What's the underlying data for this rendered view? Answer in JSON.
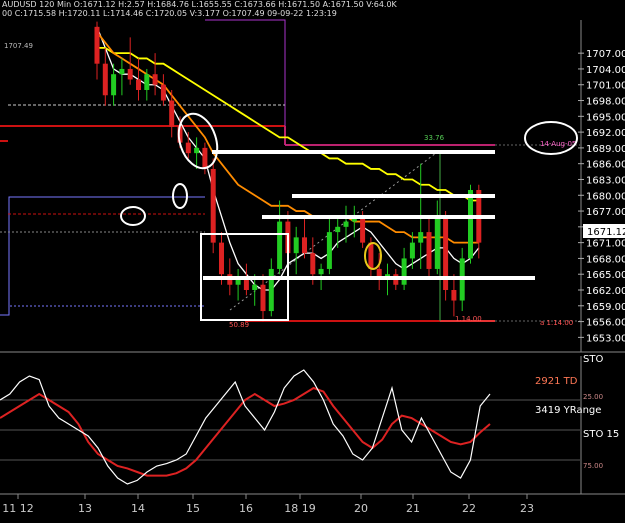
{
  "header": {
    "line1": "AUDUSD 120 Min   O:1671.12  H:2.57  H:1684.76  L:1655.55  C:1673.66  H:1671.50  A:1671.50  V:64.0K",
    "line2": "00  C:1715.58  H:1720.11  L:1714.46  C:1720.05  V:3.177  O:1707.49  09-09-22  1:23:19"
  },
  "chart_data": [
    {
      "type": "candlestick",
      "title": "AUDUSD 120 Min",
      "x_tick_labels": [
        "11 12",
        "13",
        "14",
        "15",
        "16",
        "18 19",
        "20",
        "21",
        "22",
        "23"
      ],
      "y_tick_labels": [
        "1707.00",
        "1704.00",
        "1701.00",
        "1698.00",
        "1695.00",
        "1692.00",
        "1689.00",
        "1686.00",
        "1683.00",
        "1680.00",
        "1677.00",
        "1674.00",
        "1671.00",
        "1668.00",
        "1665.00",
        "1662.00",
        "1659.00",
        "1656.00",
        "1653.00"
      ],
      "ylim": [
        1650.6,
        1713.3
      ],
      "last_price": "1671.12",
      "annotations": [
        "1707.49",
        "33.76",
        "50.89",
        "1.14.00",
        "a 1.14.00",
        "14-Aug-05"
      ],
      "candles": [
        {
          "o": 1712,
          "h": 1713,
          "l": 1702,
          "c": 1705
        },
        {
          "o": 1705,
          "h": 1708,
          "l": 1697,
          "c": 1699
        },
        {
          "o": 1699,
          "h": 1705,
          "l": 1697,
          "c": 1703
        },
        {
          "o": 1703,
          "h": 1706,
          "l": 1699,
          "c": 1704
        },
        {
          "o": 1704,
          "h": 1710,
          "l": 1701,
          "c": 1702
        },
        {
          "o": 1702,
          "h": 1706,
          "l": 1698,
          "c": 1700
        },
        {
          "o": 1700,
          "h": 1704,
          "l": 1698,
          "c": 1703
        },
        {
          "o": 1703,
          "h": 1707,
          "l": 1699,
          "c": 1701
        },
        {
          "o": 1701,
          "h": 1703,
          "l": 1697,
          "c": 1698
        },
        {
          "o": 1698,
          "h": 1700,
          "l": 1691,
          "c": 1693
        },
        {
          "o": 1693,
          "h": 1695,
          "l": 1689,
          "c": 1690
        },
        {
          "o": 1690,
          "h": 1692,
          "l": 1687,
          "c": 1688
        },
        {
          "o": 1688,
          "h": 1691,
          "l": 1685,
          "c": 1689
        },
        {
          "o": 1689,
          "h": 1690,
          "l": 1684,
          "c": 1685
        },
        {
          "o": 1685,
          "h": 1687,
          "l": 1669,
          "c": 1671
        },
        {
          "o": 1671,
          "h": 1673,
          "l": 1663,
          "c": 1665
        },
        {
          "o": 1665,
          "h": 1668,
          "l": 1661,
          "c": 1663
        },
        {
          "o": 1663,
          "h": 1666,
          "l": 1660,
          "c": 1664
        },
        {
          "o": 1664,
          "h": 1667,
          "l": 1661,
          "c": 1662
        },
        {
          "o": 1662,
          "h": 1665,
          "l": 1659,
          "c": 1663
        },
        {
          "o": 1663,
          "h": 1665,
          "l": 1656,
          "c": 1658
        },
        {
          "o": 1658,
          "h": 1668,
          "l": 1657,
          "c": 1666
        },
        {
          "o": 1666,
          "h": 1679,
          "l": 1665,
          "c": 1675
        },
        {
          "o": 1675,
          "h": 1677,
          "l": 1667,
          "c": 1669
        },
        {
          "o": 1669,
          "h": 1674,
          "l": 1665,
          "c": 1672
        },
        {
          "o": 1672,
          "h": 1676,
          "l": 1668,
          "c": 1669
        },
        {
          "o": 1669,
          "h": 1672,
          "l": 1663,
          "c": 1665
        },
        {
          "o": 1665,
          "h": 1667,
          "l": 1662,
          "c": 1666
        },
        {
          "o": 1666,
          "h": 1676,
          "l": 1665,
          "c": 1673
        },
        {
          "o": 1673,
          "h": 1676,
          "l": 1670,
          "c": 1674
        },
        {
          "o": 1674,
          "h": 1678,
          "l": 1671,
          "c": 1675
        },
        {
          "o": 1675,
          "h": 1678,
          "l": 1672,
          "c": 1676
        },
        {
          "o": 1676,
          "h": 1677,
          "l": 1670,
          "c": 1671
        },
        {
          "o": 1671,
          "h": 1672,
          "l": 1664,
          "c": 1666
        },
        {
          "o": 1666,
          "h": 1669,
          "l": 1662,
          "c": 1664
        },
        {
          "o": 1664,
          "h": 1667,
          "l": 1661,
          "c": 1665
        },
        {
          "o": 1665,
          "h": 1666,
          "l": 1662,
          "c": 1663
        },
        {
          "o": 1663,
          "h": 1670,
          "l": 1662,
          "c": 1668
        },
        {
          "o": 1668,
          "h": 1673,
          "l": 1666,
          "c": 1671
        },
        {
          "o": 1671,
          "h": 1686,
          "l": 1666,
          "c": 1673
        },
        {
          "o": 1673,
          "h": 1676,
          "l": 1664,
          "c": 1666
        },
        {
          "o": 1666,
          "h": 1679,
          "l": 1665,
          "c": 1676
        },
        {
          "o": 1676,
          "h": 1677,
          "l": 1660,
          "c": 1662
        },
        {
          "o": 1662,
          "h": 1665,
          "l": 1657,
          "c": 1660
        },
        {
          "o": 1660,
          "h": 1670,
          "l": 1658,
          "c": 1668
        },
        {
          "o": 1668,
          "h": 1682,
          "l": 1667,
          "c": 1681
        },
        {
          "o": 1681,
          "h": 1682,
          "l": 1668,
          "c": 1671
        }
      ],
      "series": [
        {
          "color": "#ffffff",
          "values": [
            1712,
            1708,
            1704,
            1703,
            1703,
            1702,
            1701,
            1701,
            1700,
            1697,
            1694,
            1691,
            1689,
            1687,
            1681,
            1676,
            1671,
            1667,
            1665,
            1663,
            1662,
            1662,
            1664,
            1667,
            1668,
            1669,
            1669,
            1668,
            1669,
            1671,
            1672,
            1673,
            1674,
            1673,
            1671,
            1669,
            1667,
            1666,
            1667,
            1668,
            1669,
            1670,
            1670,
            1668,
            1667,
            1668,
            1670
          ]
        },
        {
          "color": "#ffff00",
          "values": [
            1708,
            1708,
            1707,
            1707,
            1707,
            1706,
            1706,
            1705,
            1705,
            1704,
            1703,
            1702,
            1701,
            1700,
            1699,
            1698,
            1697,
            1696,
            1695,
            1694,
            1693,
            1692,
            1691,
            1691,
            1690,
            1689,
            1688,
            1688,
            1687,
            1687,
            1686,
            1686,
            1686,
            1685,
            1685,
            1684,
            1684,
            1683,
            1683,
            1682,
            1682,
            1681,
            1681,
            1680,
            1680,
            1679,
            1679
          ]
        },
        {
          "color": "#ff8c00",
          "values": [
            1711,
            1709,
            1707,
            1706,
            1705,
            1704,
            1703,
            1702,
            1701,
            1699,
            1697,
            1695,
            1693,
            1691,
            1688,
            1686,
            1684,
            1682,
            1681,
            1680,
            1679,
            1678,
            1678,
            1678,
            1677,
            1677,
            1676,
            1676,
            1676,
            1676,
            1676,
            1675,
            1675,
            1675,
            1675,
            1674,
            1673,
            1673,
            1672,
            1672,
            1672,
            1672,
            1672,
            1671,
            1671,
            1671,
            1671
          ]
        }
      ]
    },
    {
      "type": "line",
      "title": "STO",
      "series_label": "STO 15",
      "ylim": [
        0,
        100
      ],
      "y_tick_labels": [
        "25.00",
        "75.00"
      ],
      "texts": [
        "2921 TD",
        "3419 YRange"
      ],
      "series": [
        {
          "name": "STO",
          "color": "#ffffff",
          "values": [
            75,
            80,
            90,
            95,
            92,
            70,
            60,
            55,
            50,
            45,
            35,
            20,
            10,
            5,
            8,
            15,
            20,
            22,
            25,
            30,
            45,
            60,
            70,
            80,
            90,
            70,
            60,
            50,
            65,
            85,
            95,
            100,
            90,
            75,
            55,
            45,
            30,
            25,
            35,
            60,
            85,
            50,
            40,
            60,
            45,
            30,
            15,
            10,
            25,
            70,
            80
          ]
        },
        {
          "name": "Signal",
          "color": "#dd2222",
          "values": [
            60,
            65,
            70,
            75,
            80,
            75,
            70,
            65,
            55,
            40,
            30,
            25,
            20,
            18,
            15,
            12,
            12,
            12,
            14,
            18,
            25,
            35,
            45,
            55,
            65,
            75,
            80,
            75,
            70,
            72,
            75,
            80,
            85,
            82,
            70,
            60,
            50,
            40,
            35,
            42,
            55,
            62,
            60,
            55,
            50,
            45,
            40,
            38,
            40,
            48,
            55
          ]
        }
      ]
    }
  ]
}
